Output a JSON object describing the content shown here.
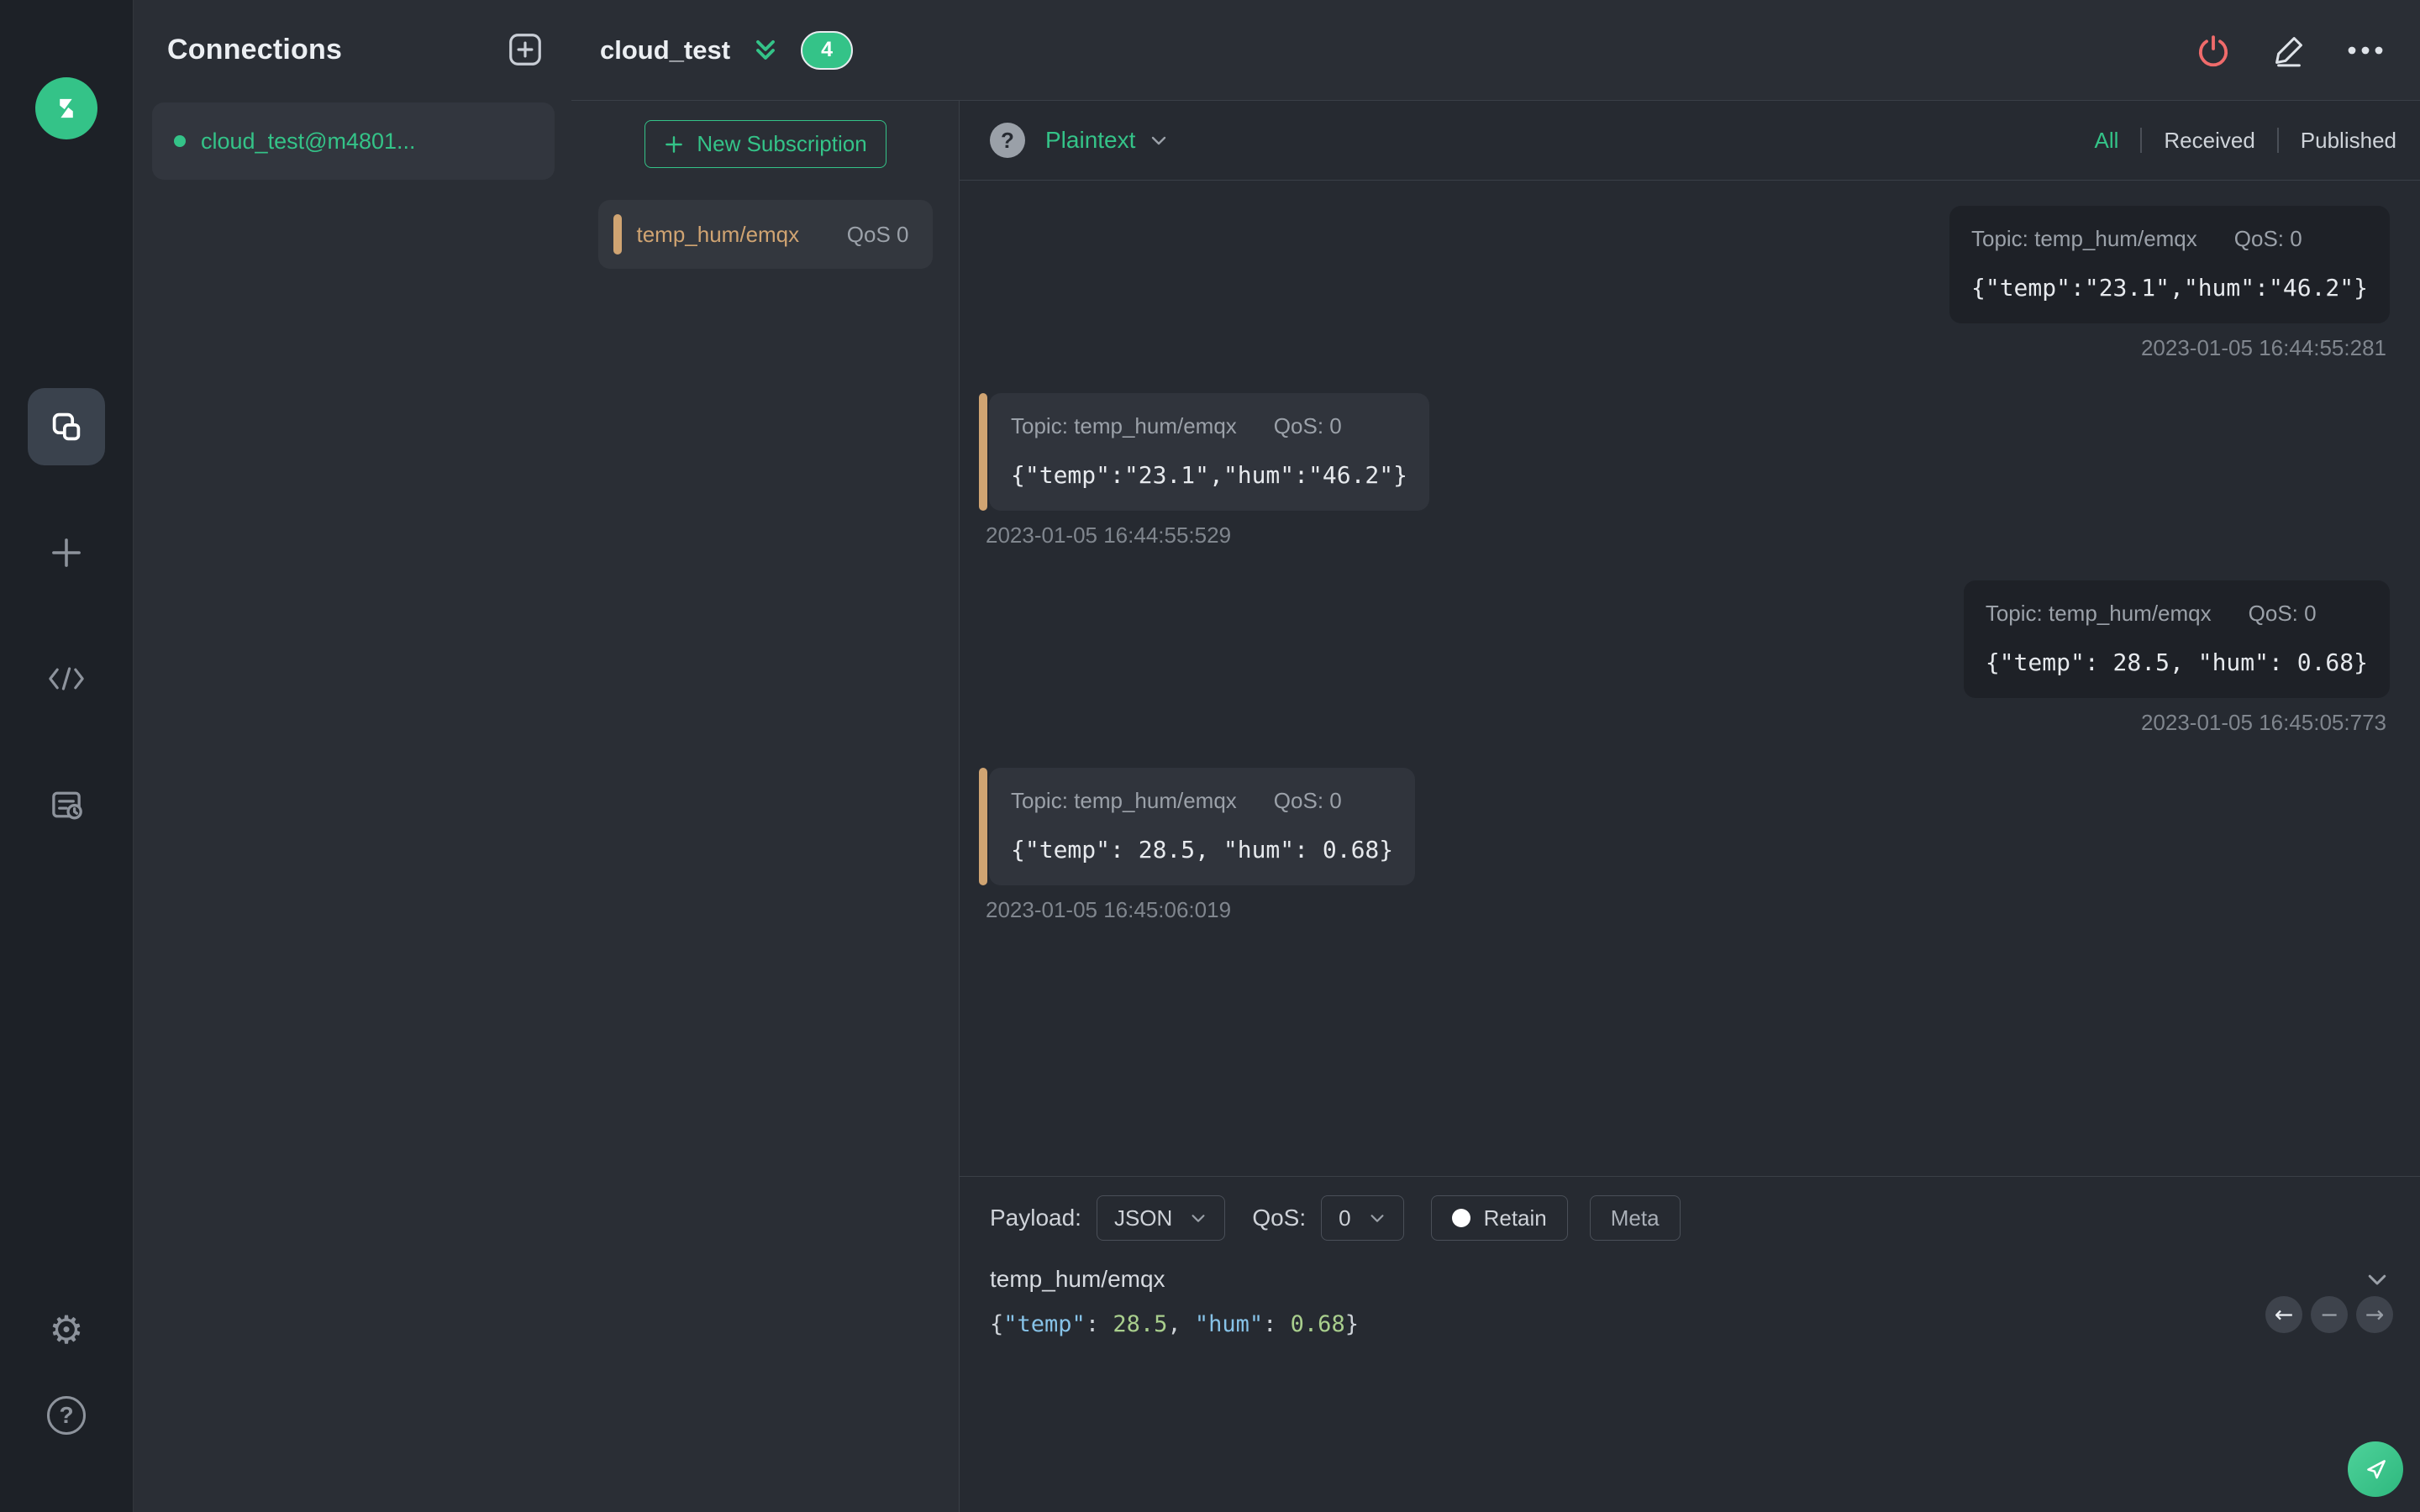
{
  "app": {
    "colors": {
      "accent_green": "#34c388",
      "danger_red": "#f06b6b",
      "topic_tan": "#d0a472",
      "received_card": "#30343c",
      "published_card": "#1e2127"
    }
  },
  "sidebar": {
    "icons": [
      "mqttx-logo",
      "connections-icon",
      "new-connection-plus-icon",
      "script-icon",
      "log-icon",
      "settings-gear-icon",
      "help-icon"
    ]
  },
  "connections_panel": {
    "title": "Connections",
    "add_icon": "add-connection-icon",
    "items": [
      {
        "name": "cloud_test@m4801...",
        "status": "connected"
      }
    ]
  },
  "topbar": {
    "title": "cloud_test",
    "badge_count": "4",
    "icons": [
      "disconnect-power-icon",
      "edit-pencil-icon",
      "more-ellipsis-icon"
    ]
  },
  "subscriptions": {
    "new_button_label": "New Subscription",
    "items": [
      {
        "topic": "temp_hum/emqx",
        "qos": "QoS 0"
      }
    ]
  },
  "messages": {
    "help_icon": "payload-format-help-icon",
    "format_label": "Plaintext",
    "filters": {
      "all": "All",
      "received": "Received",
      "published": "Published",
      "active": "All"
    },
    "list": [
      {
        "type": "published",
        "topic": "Topic: temp_hum/emqx",
        "qos": "QoS: 0",
        "payload": "{\"temp\":\"23.1\",\"hum\":\"46.2\"}",
        "time": "2023-01-05 16:44:55:281"
      },
      {
        "type": "received",
        "topic": "Topic: temp_hum/emqx",
        "qos": "QoS: 0",
        "payload": "{\"temp\":\"23.1\",\"hum\":\"46.2\"}",
        "time": "2023-01-05 16:44:55:529"
      },
      {
        "type": "published",
        "topic": "Topic: temp_hum/emqx",
        "qos": "QoS: 0",
        "payload": "{\"temp\": 28.5, \"hum\": 0.68}",
        "time": "2023-01-05 16:45:05:773"
      },
      {
        "type": "received",
        "topic": "Topic: temp_hum/emqx",
        "qos": "QoS: 0",
        "payload": "{\"temp\": 28.5, \"hum\": 0.68}",
        "time": "2023-01-05 16:45:06:019"
      }
    ]
  },
  "composer": {
    "payload_label": "Payload:",
    "payload_format": "JSON",
    "qos_label": "QoS:",
    "qos_value": "0",
    "retain_label": "Retain",
    "meta_label": "Meta",
    "topic_value": "temp_hum/emqx",
    "payload_tokens": [
      {
        "t": "{",
        "c": "punct"
      },
      {
        "t": "\"temp\"",
        "c": "key"
      },
      {
        "t": ": ",
        "c": "punct"
      },
      {
        "t": "28.5",
        "c": "num"
      },
      {
        "t": ", ",
        "c": "punct"
      },
      {
        "t": "\"hum\"",
        "c": "key"
      },
      {
        "t": ": ",
        "c": "punct"
      },
      {
        "t": "0.68",
        "c": "num"
      },
      {
        "t": "}",
        "c": "punct"
      }
    ],
    "history_arrows": [
      "prev-message-icon",
      "remove-history-icon",
      "next-message-icon"
    ],
    "send_icon": "send-paper-plane-icon"
  }
}
